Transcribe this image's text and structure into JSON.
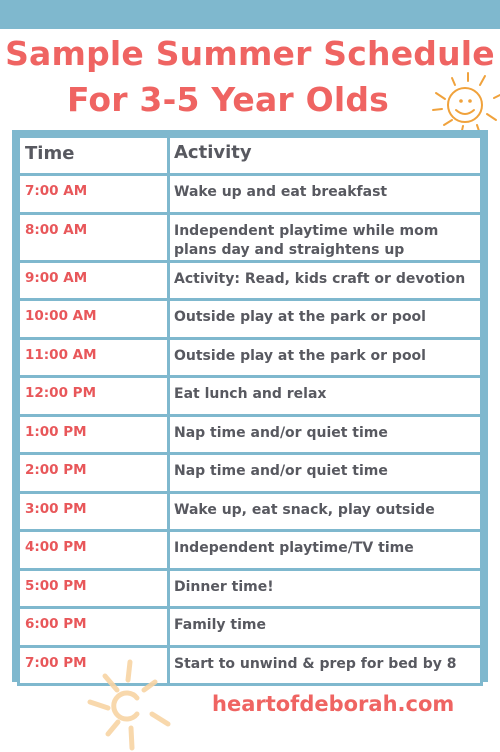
{
  "title": {
    "line1": "Sample Summer Schedule",
    "line2": "For 3-5 Year Olds"
  },
  "colors": {
    "accent_blue": "#7fb8ce",
    "title_coral": "#ef6462",
    "time_red": "#e8575a",
    "text_gray": "#585960",
    "sun_orange": "#f0a23c"
  },
  "table": {
    "headers": {
      "time": "Time",
      "activity": "Activity"
    },
    "rows": [
      {
        "time": "7:00 AM",
        "activity": "Wake up and eat breakfast"
      },
      {
        "time": "8:00 AM",
        "activity": "Independent playtime while mom plans day and straightens up"
      },
      {
        "time": "9:00 AM",
        "activity": "Activity: Read, kids craft or devotion"
      },
      {
        "time": "10:00 AM",
        "activity": "Outside play at the park or pool"
      },
      {
        "time": "11:00 AM",
        "activity": "Outside play at the park or pool"
      },
      {
        "time": "12:00 PM",
        "activity": "Eat lunch and relax"
      },
      {
        "time": "1:00 PM",
        "activity": "Nap time and/or quiet time"
      },
      {
        "time": "2:00 PM",
        "activity": "Nap time and/or quiet time"
      },
      {
        "time": "3:00 PM",
        "activity": "Wake up, eat snack, play outside"
      },
      {
        "time": "4:00 PM",
        "activity": "Independent playtime/TV time"
      },
      {
        "time": "5:00 PM",
        "activity": "Dinner time!"
      },
      {
        "time": "6:00 PM",
        "activity": "Family time"
      },
      {
        "time": "7:00 PM",
        "activity": "Start to unwind & prep for bed by 8"
      }
    ]
  },
  "footer": {
    "website": "heartofdeborah.com"
  },
  "icons": {
    "top": "smiling-sun-icon",
    "bottom": "sun-icon"
  }
}
